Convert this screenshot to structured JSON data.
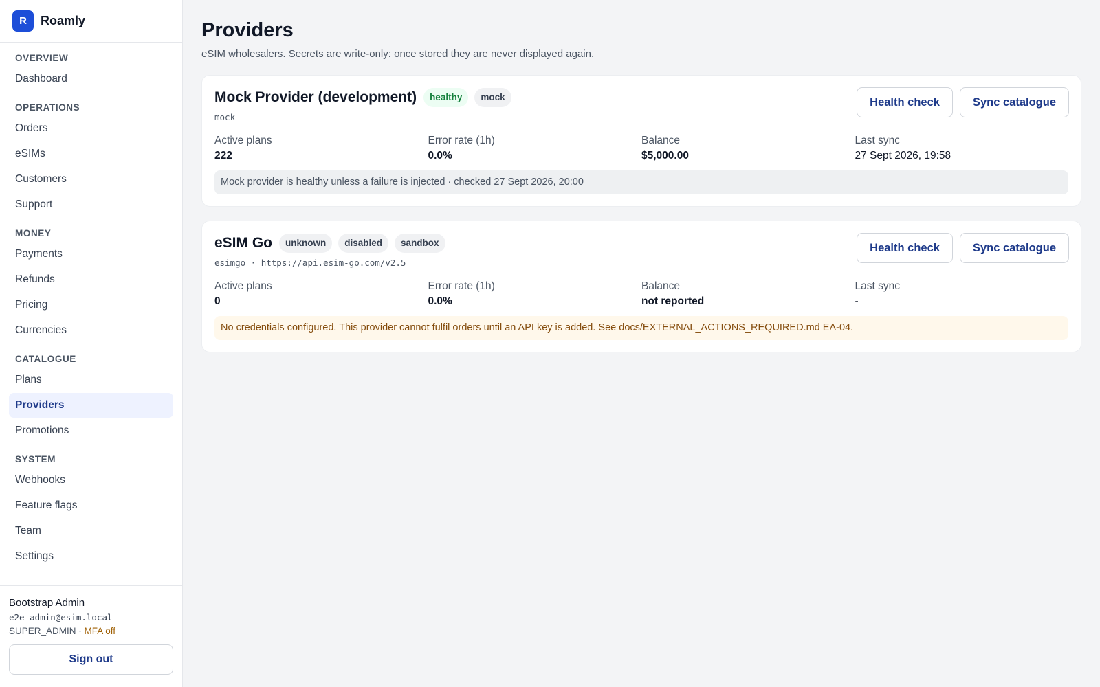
{
  "brand": {
    "logo_letter": "R",
    "name": "Roamly"
  },
  "nav": {
    "sections": [
      {
        "title": "OVERVIEW",
        "items": [
          "Dashboard"
        ]
      },
      {
        "title": "OPERATIONS",
        "items": [
          "Orders",
          "eSIMs",
          "Customers",
          "Support"
        ]
      },
      {
        "title": "MONEY",
        "items": [
          "Payments",
          "Refunds",
          "Pricing",
          "Currencies"
        ]
      },
      {
        "title": "CATALOGUE",
        "items": [
          "Plans",
          "Providers",
          "Promotions"
        ]
      },
      {
        "title": "SYSTEM",
        "items": [
          "Webhooks",
          "Feature flags",
          "Team",
          "Settings"
        ]
      }
    ],
    "active": "Providers"
  },
  "user": {
    "name": "Bootstrap Admin",
    "email": "e2e-admin@esim.local",
    "role": "SUPER_ADMIN",
    "separator": " · ",
    "mfa": "MFA off",
    "signout_label": "Sign out"
  },
  "page": {
    "title": "Providers",
    "subtitle": "eSIM wholesalers. Secrets are write-only: once stored they are never displayed again."
  },
  "providers": [
    {
      "name": "Mock Provider (development)",
      "badges": [
        {
          "text": "healthy",
          "tone": "green"
        },
        {
          "text": "mock",
          "tone": "gray"
        }
      ],
      "meta": "mock",
      "actions": {
        "health": "Health check",
        "sync": "Sync catalogue"
      },
      "stats": [
        {
          "label": "Active plans",
          "value": "222",
          "bold": true
        },
        {
          "label": "Error rate (1h)",
          "value": "0.0%",
          "bold": true
        },
        {
          "label": "Balance",
          "value": "$5,000.00",
          "bold": true
        },
        {
          "label": "Last sync",
          "value": "27 Sept 2026, 19:58",
          "bold": false
        }
      ],
      "note": {
        "text": "Mock provider is healthy unless a failure is injected · checked 27 Sept 2026, 20:00",
        "tone": "gray"
      }
    },
    {
      "name": "eSIM Go",
      "badges": [
        {
          "text": "unknown",
          "tone": "gray"
        },
        {
          "text": "disabled",
          "tone": "gray"
        },
        {
          "text": "sandbox",
          "tone": "gray"
        }
      ],
      "meta": "esimgo · https://api.esim-go.com/v2.5",
      "actions": {
        "health": "Health check",
        "sync": "Sync catalogue"
      },
      "stats": [
        {
          "label": "Active plans",
          "value": "0",
          "bold": true
        },
        {
          "label": "Error rate (1h)",
          "value": "0.0%",
          "bold": true
        },
        {
          "label": "Balance",
          "value": "not reported",
          "bold": true
        },
        {
          "label": "Last sync",
          "value": "-",
          "bold": false
        }
      ],
      "note": {
        "text": "No credentials configured. This provider cannot fulfil orders until an API key is added. See docs/EXTERNAL_ACTIONS_REQUIRED.md EA-04.",
        "tone": "warn"
      }
    }
  ]
}
